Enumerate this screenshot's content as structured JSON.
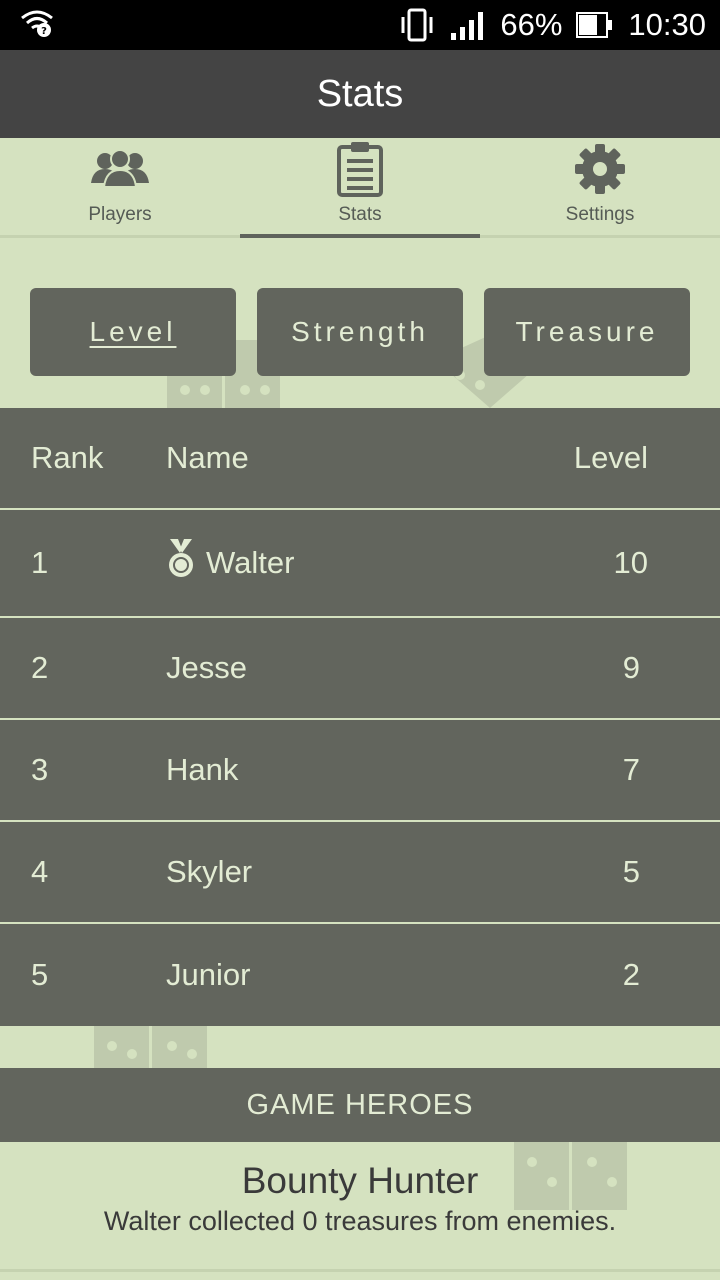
{
  "status_bar": {
    "battery_percent": "66%",
    "time": "10:30"
  },
  "header": {
    "title": "Stats"
  },
  "tabs": [
    {
      "label": "Players",
      "icon": "players-icon",
      "active": false
    },
    {
      "label": "Stats",
      "icon": "clipboard-icon",
      "active": true
    },
    {
      "label": "Settings",
      "icon": "gear-icon",
      "active": false
    }
  ],
  "sort_buttons": [
    {
      "label": "Level",
      "selected": true
    },
    {
      "label": "Strength",
      "selected": false
    },
    {
      "label": "Treasure",
      "selected": false
    }
  ],
  "table": {
    "headers": {
      "rank": "Rank",
      "name": "Name",
      "value": "Level"
    },
    "rows": [
      {
        "rank": "1",
        "name": "Walter",
        "value": "10",
        "medal": true
      },
      {
        "rank": "2",
        "name": "Jesse",
        "value": "9"
      },
      {
        "rank": "3",
        "name": "Hank",
        "value": "7"
      },
      {
        "rank": "4",
        "name": "Skyler",
        "value": "5"
      },
      {
        "rank": "5",
        "name": "Junior",
        "value": "2"
      }
    ]
  },
  "heroes": {
    "header": "GAME HEROES",
    "cards": [
      {
        "title": "Bounty Hunter",
        "description": "Walter collected 0 treasures from enemies."
      }
    ]
  },
  "colors": {
    "background": "#d5e2c0",
    "dark_panel": "#62655d",
    "header_bar": "#444444",
    "light_text": "#e3ecd4"
  }
}
